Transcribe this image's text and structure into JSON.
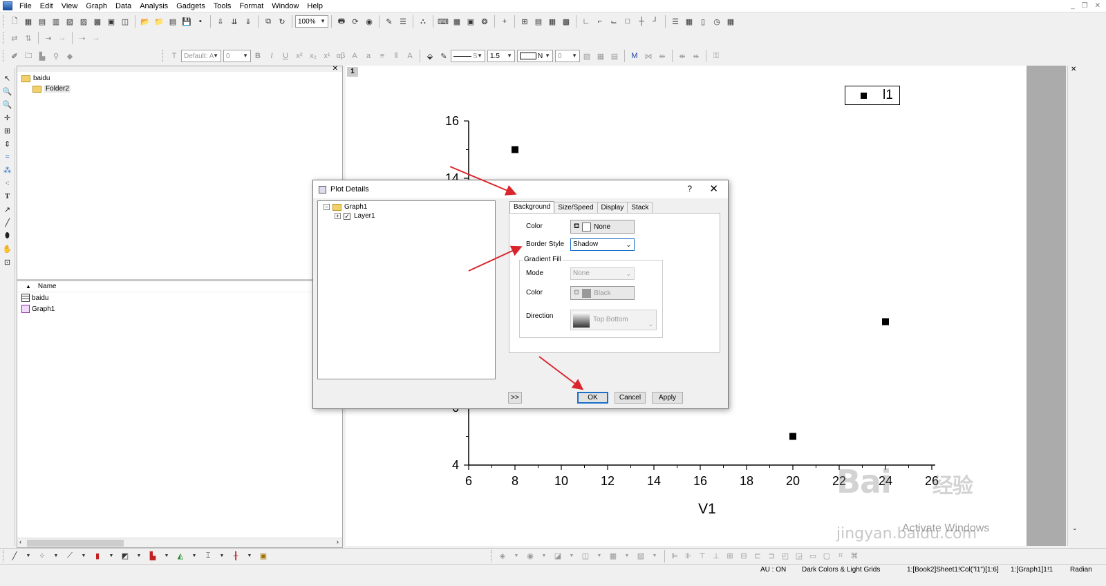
{
  "menu": {
    "items": [
      "File",
      "Edit",
      "View",
      "Graph",
      "Data",
      "Analysis",
      "Gadgets",
      "Tools",
      "Format",
      "Window",
      "Help"
    ]
  },
  "toolbar": {
    "zoom_value": "100%",
    "font_name": "Default: A",
    "font_size": "0",
    "line_style_label": "S",
    "line_width": "1.5",
    "fill_label": "N",
    "pattern_value": "0"
  },
  "project_explorer": {
    "root_folder": "baidu",
    "sub_folder": "Folder2",
    "list_header": "Name",
    "files": [
      {
        "name": "baidu",
        "icon": "workbook-icon"
      },
      {
        "name": "Graph1",
        "icon": "graph-icon"
      }
    ]
  },
  "graph": {
    "layer_number": "1",
    "legend_text": "l1",
    "xlabel": "V1"
  },
  "chart_data": {
    "type": "scatter",
    "title": "",
    "xlabel": "V1",
    "ylabel": "",
    "xlim": [
      6,
      26
    ],
    "ylim": [
      4,
      16
    ],
    "x_ticks": [
      "6",
      "8",
      "10",
      "12",
      "14",
      "16",
      "18",
      "20",
      "22",
      "24",
      "26"
    ],
    "y_ticks_visible": [
      "16",
      "14",
      "6",
      "4"
    ],
    "series": [
      {
        "name": "l1",
        "x": [
          8,
          20,
          24
        ],
        "y": [
          15,
          5,
          9
        ]
      }
    ],
    "legend": "top-right",
    "grid": false
  },
  "dialog": {
    "title": "Plot Details",
    "help": "?",
    "close": "✕",
    "tree": {
      "graph": "Graph1",
      "layer": "Layer1",
      "layer_checked": "✓"
    },
    "tabs": [
      "Background",
      "Size/Speed",
      "Display",
      "Stack"
    ],
    "background": {
      "color_label": "Color",
      "color_value": "None",
      "border_style_label": "Border Style",
      "border_style_value": "Shadow",
      "gradient_group": "Gradient Fill",
      "mode_label": "Mode",
      "mode_value": "None",
      "gradient_color_label": "Color",
      "gradient_color_value": "Black",
      "direction_label": "Direction",
      "direction_value": "Top Bottom"
    },
    "buttons": {
      "more": ">>",
      "ok": "OK",
      "cancel": "Cancel",
      "apply": "Apply"
    }
  },
  "statusbar": {
    "au": "AU : ON",
    "theme": "Dark Colors & Light Grids",
    "book": "1:[Book2]Sheet1!Col(\"l1\")[1:6]",
    "graph": "1:[Graph1]1!1",
    "angle": "Radian"
  },
  "watermark": {
    "brand": "Bai",
    "brand2": "经验",
    "url": "jingyan.baidu.com",
    "activate": "Activate Windows"
  },
  "colors": {
    "arrow": "#d9262d",
    "accent": "#1a6fc9"
  }
}
